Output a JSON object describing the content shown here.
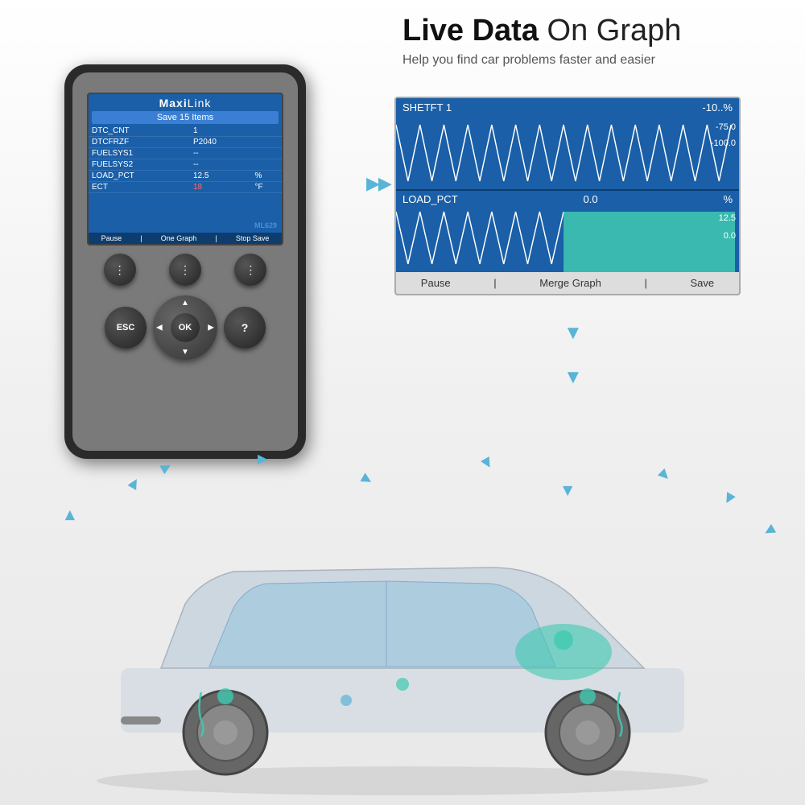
{
  "header": {
    "title_bold": "Live Data",
    "title_normal": " On Graph",
    "subtitle": "Help you find car problems faster and easier"
  },
  "graph": {
    "top_label_left": "SHETFT 1",
    "top_label_right": "-10..%",
    "right_labels_top": [
      "-75.0",
      "-100.0"
    ],
    "bottom_label_left": "LOAD_PCT",
    "bottom_label_mid": "0.0",
    "bottom_label_unit": "%",
    "right_labels_bottom": [
      "12.5",
      "0.0"
    ],
    "footer_items": [
      "Pause",
      "|",
      "Merge Graph",
      "|",
      "Save"
    ]
  },
  "scanner": {
    "brand": "MaxiLink",
    "save_bar": "Save 15 Items",
    "model": "ML629",
    "table_rows": [
      {
        "label": "DTC_CNT",
        "value": "1",
        "unit": ""
      },
      {
        "label": "DTCFRZF",
        "value": "P2040",
        "unit": ""
      },
      {
        "label": "FUELSYS1",
        "value": "--",
        "unit": ""
      },
      {
        "label": "FUELSYS2",
        "value": "--",
        "unit": ""
      },
      {
        "label": "LOAD_PCT",
        "value": "12.5",
        "unit": "%"
      },
      {
        "label": "ECT",
        "value": "18",
        "unit": "°F",
        "highlight": true
      }
    ],
    "footer_buttons": [
      "Pause",
      "One Graph",
      "Stop Save"
    ]
  },
  "buttons": {
    "dots1": "⋮",
    "dots2": "⋮",
    "dots3": "⋮",
    "esc": "ESC",
    "ok": "OK",
    "question": "?"
  },
  "colors": {
    "blue": "#1a5fa8",
    "dark": "#2a2a2a",
    "gray": "#7a7a7a",
    "teal": "#40c9b0",
    "accent": "#5ab4d6"
  }
}
